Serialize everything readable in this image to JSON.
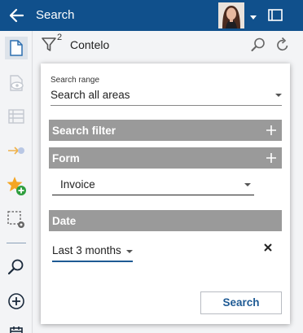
{
  "header": {
    "title": "Search",
    "icons": {
      "back": "arrow-left-icon",
      "window": "window-icon",
      "user_menu": "chevron-down-icon"
    },
    "color": "#10508c"
  },
  "searchbar": {
    "filter_count": "2",
    "value": "Contelo",
    "icons": [
      "filter-icon",
      "magnifier-icon",
      "reset-icon"
    ]
  },
  "sidebar": {
    "items": [
      {
        "icon": "document-icon",
        "active": true
      },
      {
        "icon": "preview-icon",
        "active": false
      },
      {
        "icon": "list-icon",
        "active": false
      },
      {
        "icon": "send-icon",
        "active": false
      },
      {
        "icon": "add-favorite-icon",
        "active": false
      },
      {
        "icon": "selection-settings-icon",
        "active": false
      },
      {
        "icon": "search-icon",
        "active": false
      },
      {
        "icon": "add-icon",
        "active": false
      },
      {
        "icon": "calendar-icon",
        "active": false
      }
    ]
  },
  "panel": {
    "search_range": {
      "label": "Search range",
      "value": "Search all areas"
    },
    "sections": {
      "search_filter": "Search filter",
      "form": "Form",
      "date": "Date"
    },
    "form_value": "Invoice",
    "date_value": "Last 3 months",
    "search_button": "Search"
  },
  "colors": {
    "accent": "#1e5a94",
    "section_bg": "#9a9a9a",
    "favorite": "#f5a623",
    "add_badge": "#2e9e3e"
  }
}
